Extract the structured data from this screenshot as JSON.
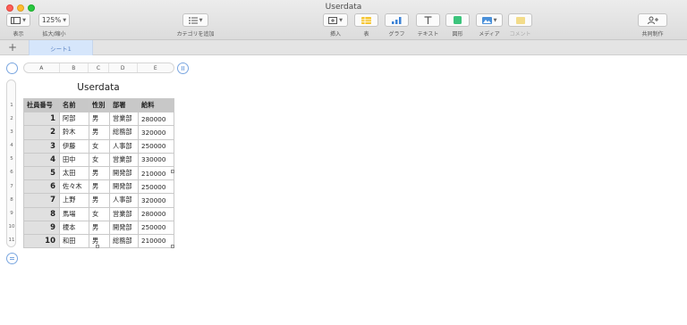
{
  "window": {
    "title": "Userdata"
  },
  "toolbar": {
    "view_label": "表示",
    "zoom_value": "125%",
    "zoom_label": "拡大/縮小",
    "category_label": "カテゴリを追加",
    "insert_label": "挿入",
    "table_label": "表",
    "chart_label": "グラフ",
    "text_label": "テキスト",
    "shape_label": "図形",
    "media_label": "メディア",
    "comment_label": "コメント",
    "collaborate_label": "共同制作"
  },
  "sheets": {
    "add": "+",
    "tabs": [
      "シート1"
    ]
  },
  "grid": {
    "columns": [
      "A",
      "B",
      "C",
      "D",
      "E"
    ],
    "rows": [
      "1",
      "2",
      "3",
      "4",
      "5",
      "6",
      "7",
      "8",
      "9",
      "10",
      "11"
    ]
  },
  "table": {
    "title": "Userdata",
    "headers": [
      "社員番号",
      "名前",
      "性別",
      "部署",
      "給料"
    ],
    "rows": [
      [
        "1",
        "阿部",
        "男",
        "営業部",
        "280000"
      ],
      [
        "2",
        "鈴木",
        "男",
        "総務部",
        "320000"
      ],
      [
        "3",
        "伊藤",
        "女",
        "人事部",
        "250000"
      ],
      [
        "4",
        "田中",
        "女",
        "営業部",
        "330000"
      ],
      [
        "5",
        "太田",
        "男",
        "開発部",
        "210000"
      ],
      [
        "6",
        "佐々木",
        "男",
        "開発部",
        "250000"
      ],
      [
        "7",
        "上野",
        "男",
        "人事部",
        "320000"
      ],
      [
        "8",
        "馬場",
        "女",
        "営業部",
        "280000"
      ],
      [
        "9",
        "榎本",
        "男",
        "開発部",
        "250000"
      ],
      [
        "10",
        "和田",
        "男",
        "総務部",
        "210000"
      ]
    ]
  }
}
